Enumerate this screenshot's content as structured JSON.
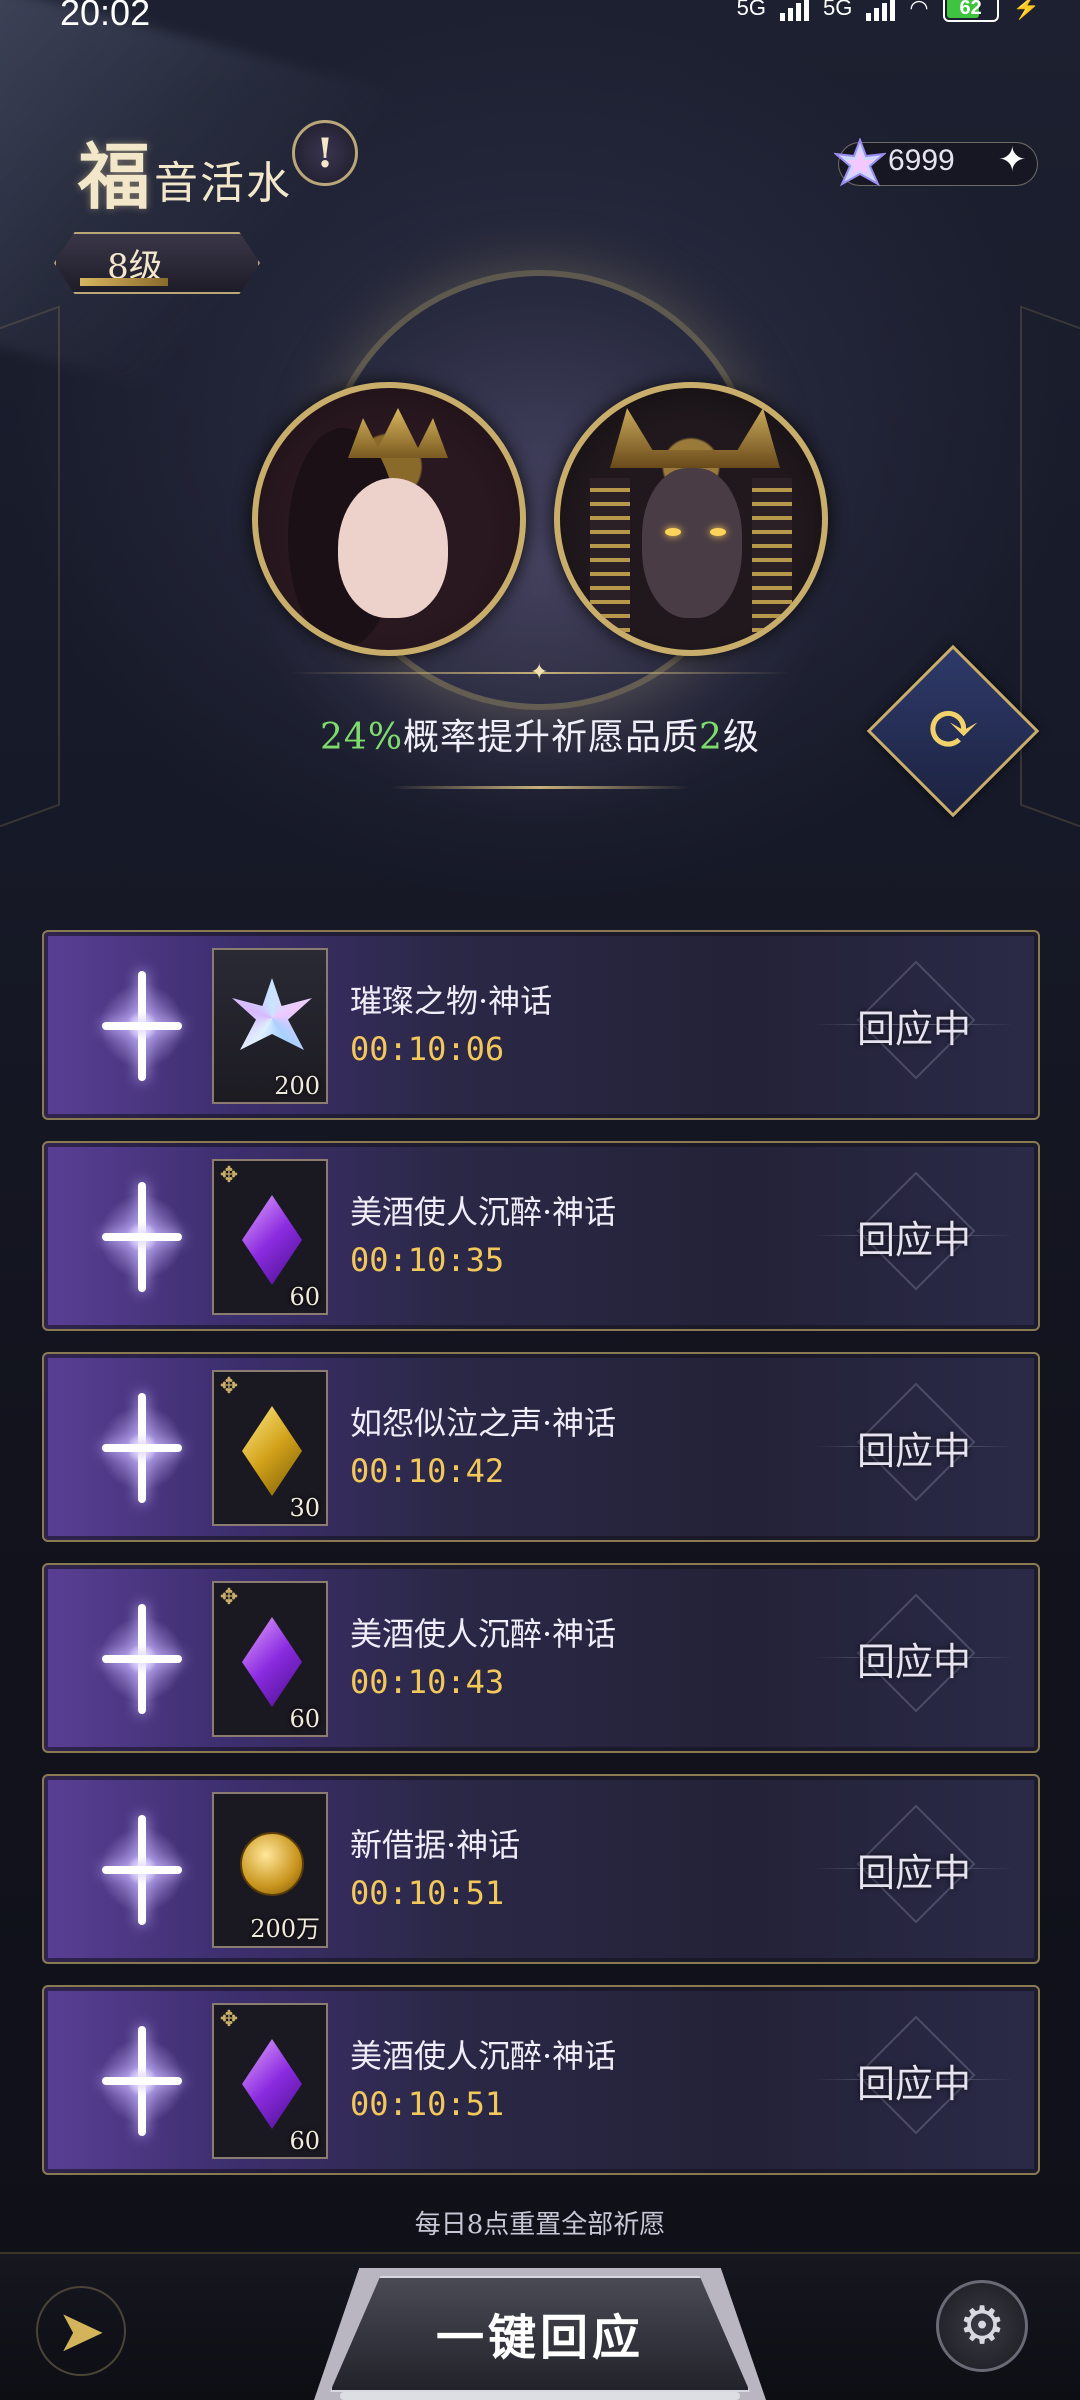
{
  "status_bar": {
    "time": "20:02",
    "network1": "5G",
    "network2": "5G",
    "battery": "62",
    "charging_icon": "bolt-icon"
  },
  "header": {
    "title_first": "福",
    "title_rest": "音活水",
    "info_icon": "exclamation-icon",
    "level": "8级",
    "level_progress": 0.55,
    "currency_count": "6999",
    "currency_icon": "crystal-icon",
    "add_icon": "sparkle-plus-icon"
  },
  "boost": {
    "percent": "24%",
    "text_middle": "概率提升祈愿品质",
    "level_num": "2",
    "text_end": "级"
  },
  "wishes": [
    {
      "name": "璀璨之物·神话",
      "timer": "00:10:06",
      "count": "200",
      "item_type": "crystal",
      "status": "回应中"
    },
    {
      "name": "美酒使人沉醉·神话",
      "timer": "00:10:35",
      "count": "60",
      "item_type": "purple-gem",
      "status": "回应中"
    },
    {
      "name": "如怨似泣之声·神话",
      "timer": "00:10:42",
      "count": "30",
      "item_type": "gold-gem",
      "status": "回应中"
    },
    {
      "name": "美酒使人沉醉·神话",
      "timer": "00:10:43",
      "count": "60",
      "item_type": "purple-gem",
      "status": "回应中"
    },
    {
      "name": "新借据·神话",
      "timer": "00:10:51",
      "count": "200万",
      "item_type": "coin",
      "status": "回应中"
    },
    {
      "name": "美酒使人沉醉·神话",
      "timer": "00:10:51",
      "count": "60",
      "item_type": "purple-gem",
      "status": "回应中"
    }
  ],
  "footer": {
    "reset_note": "每日8点重置全部祈愿",
    "one_key_label": "一键回应",
    "back_icon": "back-arrow-icon",
    "settings_icon": "gear-icon"
  },
  "colors": {
    "accent_gold": "#c9ad6a",
    "timer_yellow": "#f3c85a",
    "boost_green": "#7fdc6c"
  }
}
